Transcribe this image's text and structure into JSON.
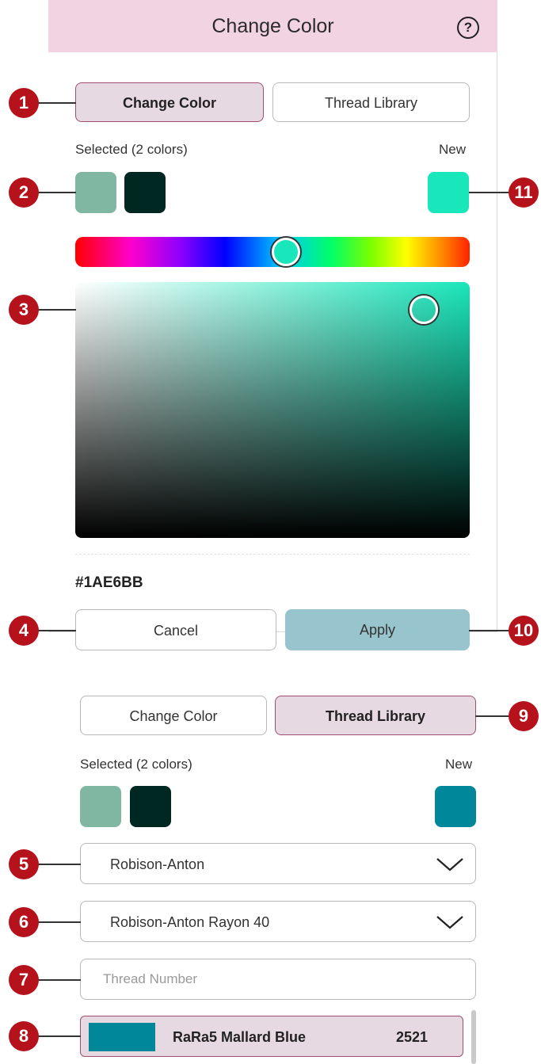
{
  "colors": {
    "header_bg": "#f2d3e2",
    "accent_border": "#a24c74",
    "callout": "#b5121b",
    "selected_1": "#7fb7a3",
    "selected_2": "#002822",
    "new_top": "#1ae6bb",
    "new_bottom": "#008799",
    "thread_chip": "#008799"
  },
  "top": {
    "title": "Change Color",
    "help_icon": "?",
    "tab_change_color": "Change Color",
    "tab_thread_library": "Thread Library",
    "selected_label": "Selected (2 colors)",
    "new_label": "New",
    "hex_value": "#1AE6BB",
    "cancel": "Cancel",
    "apply": "Apply"
  },
  "bottom": {
    "tab_change_color": "Change Color",
    "tab_thread_library": "Thread Library",
    "selected_label": "Selected (2 colors)",
    "new_label": "New",
    "brand_select": "Robison-Anton",
    "series_select": "Robison-Anton Rayon 40",
    "thread_number_placeholder": "Thread Number",
    "result_name": "RaRa5 Mallard Blue",
    "result_number": "2521"
  },
  "callouts": [
    "1",
    "2",
    "3",
    "4",
    "5",
    "6",
    "7",
    "8",
    "9",
    "10",
    "11"
  ]
}
